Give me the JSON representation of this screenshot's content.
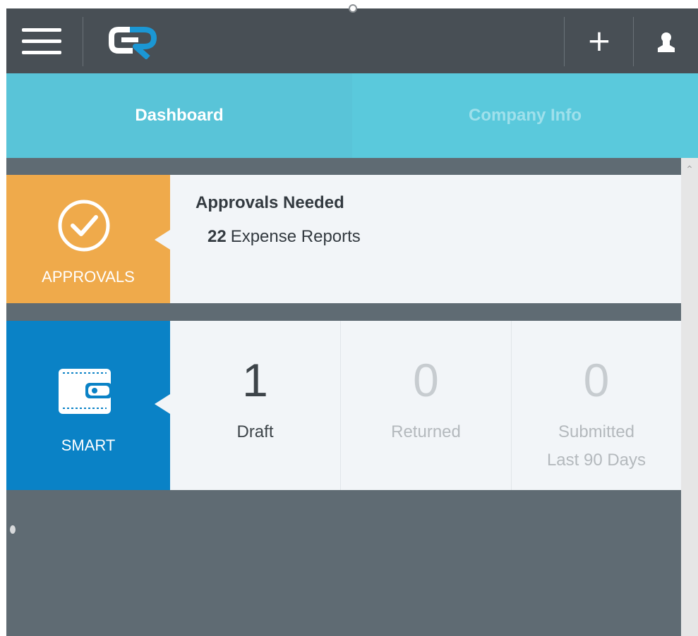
{
  "header": {
    "logo_text": "CR",
    "add_label": "+",
    "icons": [
      "hamburger-menu-icon",
      "user-icon"
    ]
  },
  "tabs": [
    {
      "label": "Dashboard",
      "active": true
    },
    {
      "label": "Company Info",
      "active": false
    }
  ],
  "approvals": {
    "tile_label": "APPROVALS",
    "title": "Approvals Needed",
    "count": "22",
    "item_label": "Expense Reports",
    "icon": "checkmark-circle-icon"
  },
  "smart": {
    "tile_label": "SMART",
    "icon": "wallet-icon",
    "stats": [
      {
        "number": "1",
        "label": "Draft"
      },
      {
        "number": "0",
        "label": "Returned"
      },
      {
        "number": "0",
        "label": "Submitted Last 90 Days"
      }
    ]
  },
  "colors": {
    "header_bg": "#484f55",
    "tab_bg": "#59c4d8",
    "approvals_accent": "#efaa4b",
    "smart_accent": "#0a82c6",
    "page_bg": "#5f6b73"
  }
}
